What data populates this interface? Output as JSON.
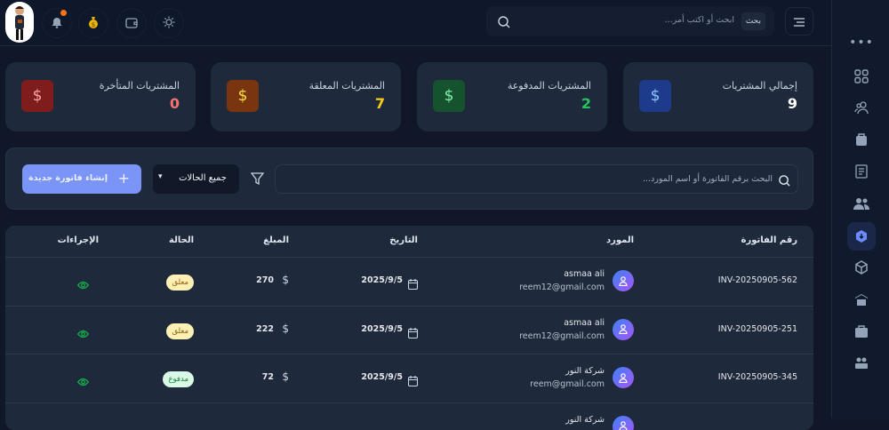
{
  "header": {
    "search_placeholder": "ابحث أو اكتب أمر...",
    "search_badge": "بحث",
    "notification_dot_color": "#f97316"
  },
  "stats": [
    {
      "label": "إجمالي المشتريات",
      "value": "9",
      "color": "#ffffff",
      "icon_bg": "#1e3a8a",
      "icon_color": "#93c5fd"
    },
    {
      "label": "المشتريات المدفوعة",
      "value": "2",
      "color": "#22c55e",
      "icon_bg": "#14532d",
      "icon_color": "#86efac"
    },
    {
      "label": "المشتريات المعلقة",
      "value": "7",
      "color": "#facc15",
      "icon_bg": "#78350f",
      "icon_color": "#fde047"
    },
    {
      "label": "المشتريات المتأخرة",
      "value": "0",
      "color": "#f87171",
      "icon_bg": "#7f1d1d",
      "icon_color": "#fca5a5"
    }
  ],
  "filters": {
    "search_placeholder": "البحث برقم الفاتورة أو اسم المورد...",
    "status_select": "جميع الحالات",
    "create_button": "إنشاء فاتورة جديدة"
  },
  "table": {
    "headers": {
      "invoice": "رقم الفاتورة",
      "supplier": "المورد",
      "date": "التاريخ",
      "amount": "المبلغ",
      "status": "الحالة",
      "actions": "الإجراءات"
    },
    "rows": [
      {
        "invoice": "INV-20250905-562",
        "name": "asmaa ali",
        "email": "reem12@gmail.com",
        "date": "2025/9/5",
        "amount": "270",
        "status": "معلق",
        "status_type": "pending"
      },
      {
        "invoice": "INV-20250905-251",
        "name": "asmaa ali",
        "email": "reem12@gmail.com",
        "date": "2025/9/5",
        "amount": "222",
        "status": "معلق",
        "status_type": "pending"
      },
      {
        "invoice": "INV-20250905-345",
        "name": "شركة النور",
        "email": "reem@gmail.com",
        "date": "2025/9/5",
        "amount": "72",
        "status": "مدفوع",
        "status_type": "paid"
      },
      {
        "invoice": "",
        "name": "شركة النور",
        "email": "",
        "date": "",
        "amount": "",
        "status": "",
        "status_type": ""
      }
    ]
  }
}
